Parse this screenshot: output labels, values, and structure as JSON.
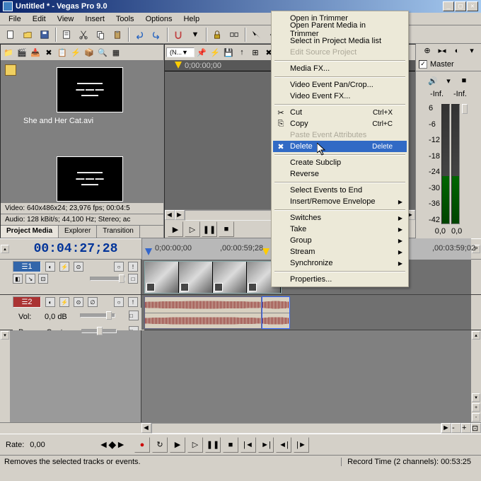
{
  "window": {
    "title": "Untitled * - Vegas Pro 9.0"
  },
  "menu": [
    "File",
    "Edit",
    "View",
    "Insert",
    "Tools",
    "Options",
    "Help"
  ],
  "media": {
    "filename": "She and Her Cat.avi",
    "video_info": "Video: 640x486x24; 23,976 fps; 00:04:5",
    "audio_info": "Audio: 128 kBit/s; 44,100 Hz; Stereo; ac",
    "tabs": [
      "Project Media",
      "Explorer",
      "Transition"
    ]
  },
  "trimmer": {
    "start": "0;00:00;00"
  },
  "mixer": {
    "label": "Master",
    "inf_l": "-Inf.",
    "inf_r": "-Inf.",
    "ticks": [
      "6",
      "-6",
      "-12",
      "-18",
      "-24",
      "-30",
      "-36",
      "-42"
    ],
    "bottom_l": "0,0",
    "bottom_r": "0,0"
  },
  "timecode": "00:04:27;28",
  "ruler": {
    "t1": "0;00:00;00",
    "t2": ",00:00:59;28",
    "t3": ",00:03:59;02"
  },
  "tracks": {
    "video_num": "1",
    "audio_num": "2",
    "vol_label": "Vol:",
    "vol_value": "0,0 dB",
    "pan_label": "Pan:",
    "pan_value": "Center"
  },
  "rate": {
    "label": "Rate:",
    "value": "0,00"
  },
  "status": {
    "hint": "Removes the selected tracks or events.",
    "record": "Record Time (2 channels):",
    "record_val": "00:53:25"
  },
  "context": {
    "open_trimmer": "Open in Trimmer",
    "open_parent": "Open Parent Media in Trimmer",
    "select_pm": "Select in Project Media list",
    "edit_source": "Edit Source Project",
    "media_fx": "Media FX...",
    "pan_crop": "Video Event Pan/Crop...",
    "event_fx": "Video Event FX...",
    "cut": "Cut",
    "cut_key": "Ctrl+X",
    "copy": "Copy",
    "copy_key": "Ctrl+C",
    "paste_attr": "Paste Event Attributes",
    "delete": "Delete",
    "delete_key": "Delete",
    "subclip": "Create Subclip",
    "reverse": "Reverse",
    "select_end": "Select Events to End",
    "envelope": "Insert/Remove Envelope",
    "switches": "Switches",
    "take": "Take",
    "group": "Group",
    "stream": "Stream",
    "sync": "Synchronize",
    "props": "Properties..."
  }
}
